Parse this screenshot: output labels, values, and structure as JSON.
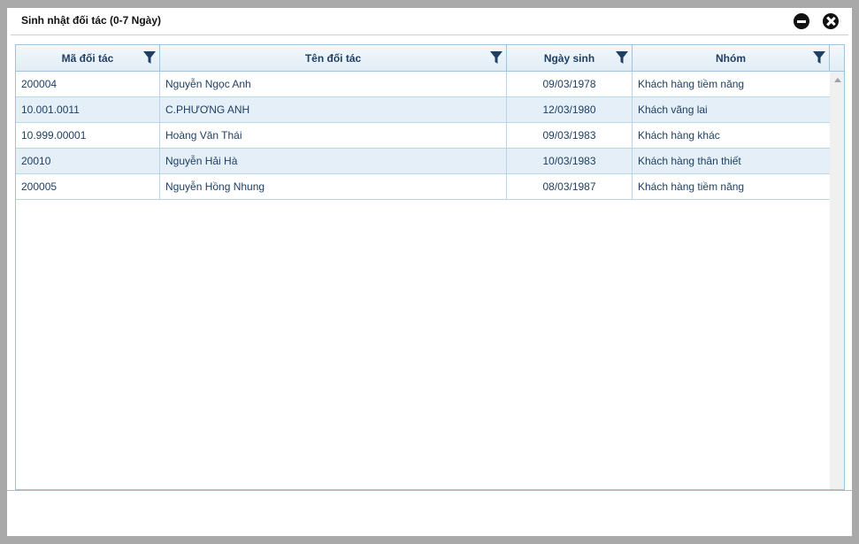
{
  "window": {
    "title": "Sinh nhật đối tác (0-7 Ngày)",
    "minimize_icon": "minus-circle-icon",
    "close_icon": "x-circle-icon"
  },
  "table": {
    "columns": [
      {
        "label": "Mã đối tác",
        "filter_icon": "filter-icon"
      },
      {
        "label": "Tên đối tác",
        "filter_icon": "filter-icon"
      },
      {
        "label": "Ngày sinh",
        "filter_icon": "filter-icon"
      },
      {
        "label": "Nhóm",
        "filter_icon": "filter-icon"
      }
    ],
    "rows": [
      {
        "ma": "200004",
        "ten": "Nguyễn Ngọc Anh",
        "ngay": "09/03/1978",
        "nhom": "Khách hàng tiềm năng"
      },
      {
        "ma": "10.001.0011",
        "ten": "C.PHƯƠNG ANH",
        "ngay": "12/03/1980",
        "nhom": "Khách vãng lai"
      },
      {
        "ma": "10.999.00001",
        "ten": "Hoàng Văn Thái",
        "ngay": "09/03/1983",
        "nhom": "Khách hàng khác"
      },
      {
        "ma": "20010",
        "ten": "Nguyễn Hải Hà",
        "ngay": "10/03/1983",
        "nhom": "Khách hàng thân thiết"
      },
      {
        "ma": "200005",
        "ten": "Nguyễn Hồng Nhung",
        "ngay": "08/03/1987",
        "nhom": "Khách hàng tiềm năng"
      }
    ]
  },
  "colors": {
    "header_text": "#1f3f63",
    "grid_border": "#9ec5e0",
    "alt_row": "#e4eff7"
  }
}
